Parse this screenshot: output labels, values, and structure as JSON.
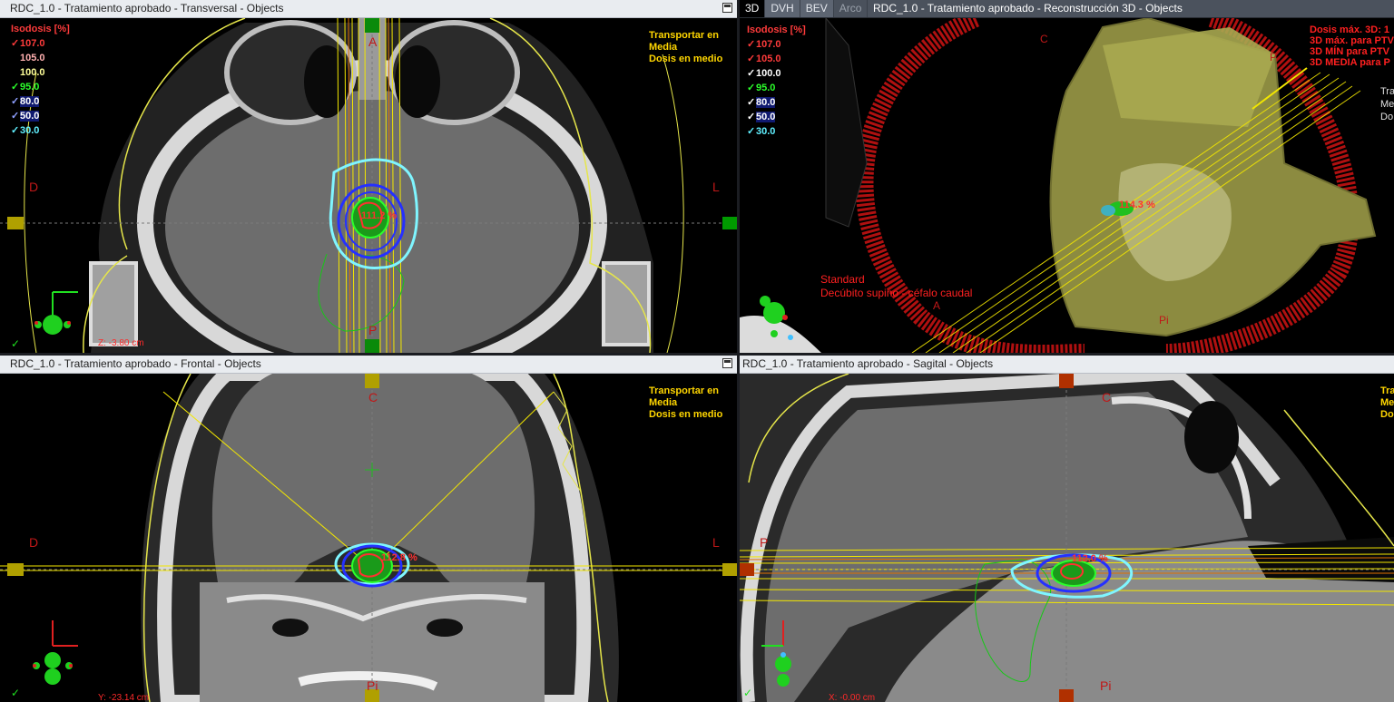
{
  "panels": {
    "transversal": {
      "title": "RDC_1.0  -  Tratamiento aprobado - Transversal - Objects",
      "coord": "Z: -3.80 cm",
      "dose_label": "111.2 %",
      "orient": {
        "top": "A",
        "bottom": "P",
        "left": "D",
        "right": "L"
      }
    },
    "recon3d": {
      "title": "RDC_1.0  -  Tratamiento aprobado - Reconstrucción 3D - Objects",
      "dose_label": "114.3 %",
      "tabs": [
        "3D",
        "DVH",
        "BEV",
        "Arco"
      ],
      "position_lines": [
        "Standard",
        "Decúbito supino - céfalo caudal"
      ],
      "stats_lines": [
        "Dosis máx. 3D: 1",
        "3D máx. para PTV",
        "3D MÍN para PTV",
        "3D MEDIA para P"
      ],
      "orient": {
        "top": "C",
        "bottom": "Pi",
        "left": "A",
        "top_right": "P"
      },
      "right_edge": [
        "Tra",
        "Me",
        "Do"
      ]
    },
    "frontal": {
      "title": "RDC_1.0  -  Tratamiento aprobado - Frontal - Objects",
      "coord": "Y: -23.14 cm",
      "dose_label": "112.8 %",
      "orient": {
        "top": "C",
        "bottom": "Pi",
        "left": "D",
        "right": "L"
      }
    },
    "sagital": {
      "title": "RDC_1.0  -  Tratamiento aprobado - Sagital - Objects",
      "coord": "X: -0.00 cm",
      "dose_label": "112.0 %",
      "orient": {
        "top": "C",
        "bottom": "Pi",
        "left": "P"
      },
      "right_edge": [
        "Tra",
        "Me",
        "Do"
      ]
    }
  },
  "overlay_text": {
    "transport": "Transportar en",
    "media": "Media",
    "dosis_medio": "Dosis en medio"
  },
  "isodose": {
    "title": "Isodosis [%]",
    "levels": [
      {
        "value": "107.0",
        "checked": true,
        "color": "#ff3b3b"
      },
      {
        "value": "105.0",
        "checked": false,
        "color": "#ffb0b0"
      },
      {
        "value": "100.0",
        "checked": false,
        "color": "#ffff9a"
      },
      {
        "value": "95.0",
        "checked": true,
        "color": "#2bff2b"
      },
      {
        "value": "80.0",
        "checked": true,
        "color": "#3a46ff"
      },
      {
        "value": "50.0",
        "checked": true,
        "color": "#3a46ff"
      },
      {
        "value": "30.0",
        "checked": true,
        "color": "#60f0ff"
      }
    ]
  },
  "iso3d": {
    "title": "Isodosis [%]",
    "levels": [
      {
        "value": "107.0",
        "checked": true,
        "color": "#ff3b3b"
      },
      {
        "value": "105.0",
        "checked": true,
        "color": "#ff3b3b"
      },
      {
        "value": "100.0",
        "checked": true,
        "color": "#ffffff"
      },
      {
        "value": "95.0",
        "checked": true,
        "color": "#2bff2b"
      },
      {
        "value": "80.0",
        "checked": true,
        "color": "#ffffff"
      },
      {
        "value": "50.0",
        "checked": true,
        "color": "#ffffff"
      },
      {
        "value": "30.0",
        "checked": true,
        "color": "#60f0ff"
      }
    ]
  },
  "status": {
    "ok_mark": "✓"
  },
  "colors": {
    "accent_red": "#ff2020",
    "label_yellow": "#ffd600",
    "beam_yellow": "#f2e600",
    "contour_cyan": "#7ff5ff",
    "contour_blue": "#2530ff",
    "contour_green": "#16c816"
  }
}
